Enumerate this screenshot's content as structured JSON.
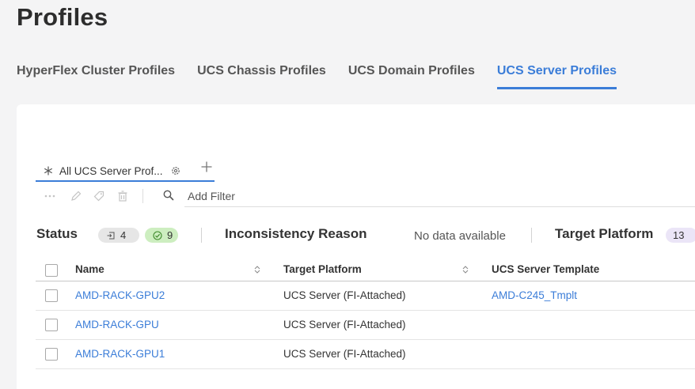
{
  "page": {
    "title": "Profiles"
  },
  "tabs": [
    {
      "label": "HyperFlex Cluster Profiles",
      "active": false
    },
    {
      "label": "UCS Chassis Profiles",
      "active": false
    },
    {
      "label": "UCS Domain Profiles",
      "active": false
    },
    {
      "label": "UCS Server Profiles",
      "active": true
    }
  ],
  "view_tab": {
    "label": "All UCS Server Prof...",
    "icon": "asterisk-icon",
    "settings_icon": "gear-icon",
    "add_icon": "plus-icon"
  },
  "toolbar": {
    "icons": [
      "more-icon",
      "edit-icon",
      "tag-icon",
      "delete-icon"
    ],
    "search_icon": "search-icon",
    "filter_placeholder": "Add Filter"
  },
  "summary": {
    "status": {
      "label": "Status",
      "not_deployed_count": "4",
      "ok_count": "9"
    },
    "inconsistency": {
      "label": "Inconsistency Reason",
      "value": "No data available"
    },
    "target_platform": {
      "label": "Target Platform",
      "count": "13"
    }
  },
  "table": {
    "columns": [
      "Name",
      "Target Platform",
      "UCS Server Template"
    ],
    "rows": [
      {
        "name": "AMD-RACK-GPU2",
        "platform": "UCS Server (FI-Attached)",
        "template": "AMD-C245_Tmplt"
      },
      {
        "name": "AMD-RACK-GPU",
        "platform": "UCS Server (FI-Attached)",
        "template": ""
      },
      {
        "name": "AMD-RACK-GPU1",
        "platform": "UCS Server (FI-Attached)",
        "template": ""
      }
    ]
  },
  "colors": {
    "accent": "#3b7dd8",
    "ok_pill": "#cdeec0",
    "neutral_pill": "#e6e6e6",
    "purple_pill": "#ebe5f7"
  }
}
